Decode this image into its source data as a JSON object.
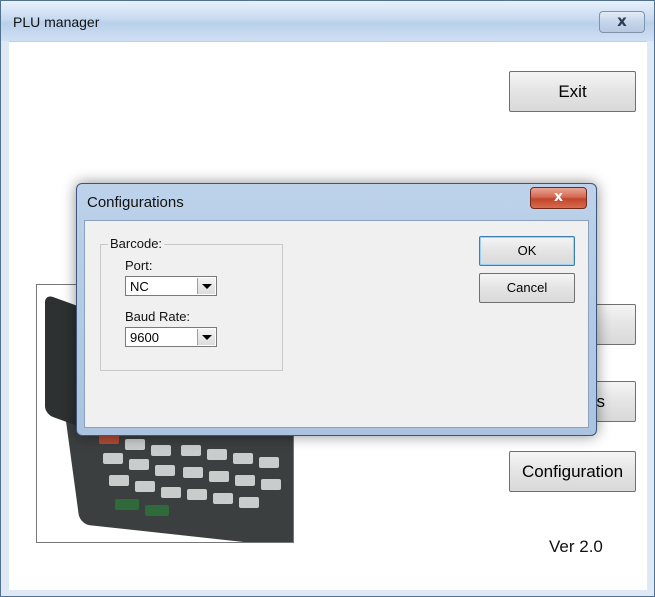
{
  "main_window": {
    "title": "PLU manager",
    "close_glyph": "x",
    "buttons": {
      "exit": "Exit",
      "partial": "s",
      "configuration": "Configuration"
    },
    "version": "Ver 2.0"
  },
  "dialog": {
    "title": "Configurations",
    "close_glyph": "x",
    "group_label": "Barcode:",
    "port_label": "Port:",
    "port_value": "NC",
    "baud_label": "Baud Rate:",
    "baud_value": "9600",
    "ok_label": "OK",
    "cancel_label": "Cancel"
  },
  "icons": [
    "close-icon",
    "dropdown-arrow-icon"
  ],
  "colors": {
    "titlebar": "#c7daf0",
    "close_red": "#c3452b",
    "dialog_bg": "#f0f0f0"
  }
}
